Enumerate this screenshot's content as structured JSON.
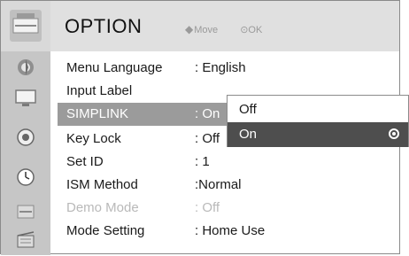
{
  "header": {
    "title": "OPTION",
    "hint_move_icon": "◆",
    "hint_move": "Move",
    "hint_ok_icon": "⊙",
    "hint_ok": "OK"
  },
  "sidebar": {
    "items": [
      {
        "icon": "picture-icon"
      },
      {
        "icon": "monitor-icon"
      },
      {
        "icon": "speaker-icon"
      },
      {
        "icon": "clock-icon"
      },
      {
        "icon": "option-icon"
      },
      {
        "icon": "input-icon"
      }
    ]
  },
  "menu": {
    "items": [
      {
        "label": "Menu Language",
        "value": ": English"
      },
      {
        "label": "Input Label",
        "value": ""
      },
      {
        "label": "SIMPLINK",
        "value": ": On"
      },
      {
        "label": "Key Lock",
        "value": ": Off"
      },
      {
        "label": "Set ID",
        "value": ": 1"
      },
      {
        "label": "ISM Method",
        "value": ":Normal"
      },
      {
        "label": "Demo Mode",
        "value": ": Off"
      },
      {
        "label": "Mode Setting",
        "value": ": Home Use"
      }
    ]
  },
  "popup": {
    "options": [
      {
        "label": "Off"
      },
      {
        "label": "On"
      }
    ],
    "selected": "On"
  },
  "colors": {
    "header_bg": "#e0e0e0",
    "sidebar_bg": "#c6c6c6",
    "selected_row": "#9b9b9b",
    "popup_selected": "#4e4e4e",
    "disabled_text": "#b9b9b9"
  }
}
